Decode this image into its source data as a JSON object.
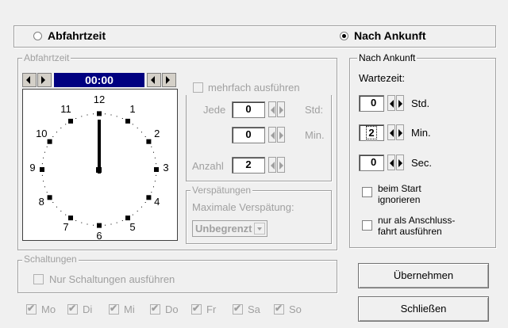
{
  "mode": {
    "abfahrtzeit_label": "Abfahrtzeit",
    "nach_ankunft_label": "Nach Ankunft",
    "selected": "nach_ankunft"
  },
  "abfahrtzeit_group": {
    "legend": "Abfahrtzeit",
    "time": "00:00",
    "clock_numbers": [
      "12",
      "1",
      "2",
      "3",
      "4",
      "5",
      "6",
      "7",
      "8",
      "9",
      "10",
      "11"
    ],
    "mehrfach_label": "mehrfach ausführen",
    "jede_label": "Jede",
    "jede_value": "0",
    "std_unit": "Std:",
    "min_value": "0",
    "min_unit": "Min.",
    "anzahl_label": "Anzahl",
    "anzahl_value": "2",
    "verspaetungen_legend": "Verspätungen",
    "max_verspaetung_label": "Maximale Verspätung:",
    "max_verspaetung_value": "Unbegrenzt"
  },
  "schaltungen": {
    "legend": "Schaltungen",
    "nur_label": "Nur Schaltungen ausführen",
    "days": [
      "Mo",
      "Di",
      "Mi",
      "Do",
      "Fr",
      "Sa",
      "So"
    ]
  },
  "nach_ankunft_group": {
    "legend": "Nach Ankunft",
    "wartezeit_label": "Wartezeit:",
    "std_value": "0",
    "std_unit": "Std.",
    "min_value": "2",
    "min_unit": "Min.",
    "sec_value": "0",
    "sec_unit": "Sec.",
    "beim_start_label_1": "beim Start",
    "beim_start_label_2": "ignorieren",
    "anschluss_label_1": "nur als Anschluss-",
    "anschluss_label_2": "fahrt ausführen"
  },
  "buttons": {
    "uebernehmen": "Übernehmen",
    "schliessen": "Schließen"
  },
  "colors": {
    "time_display_bg": "#000080",
    "time_display_fg": "#ffffff"
  }
}
